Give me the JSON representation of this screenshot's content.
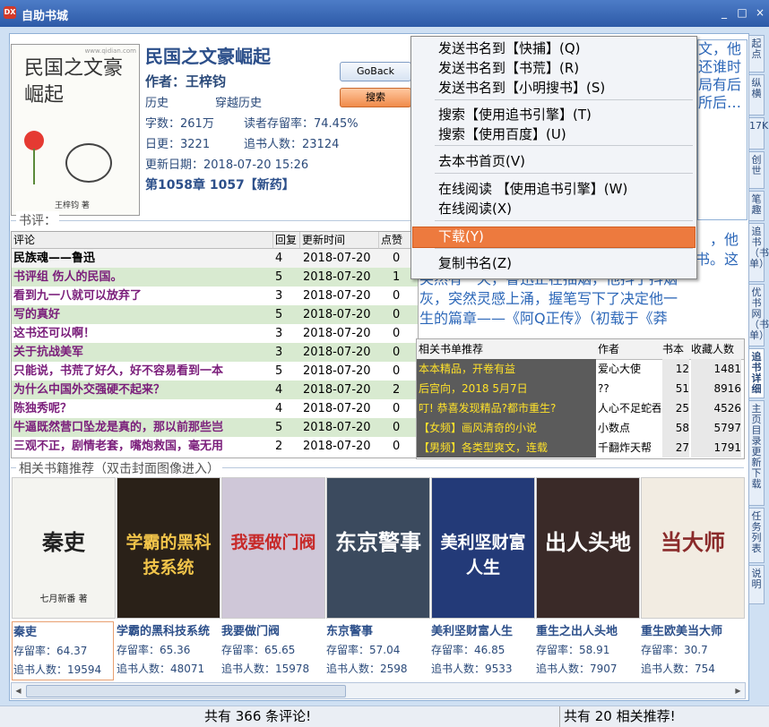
{
  "window": {
    "title": "自助书城",
    "icon_label": "DX",
    "buttons": [
      "_",
      "□",
      "×"
    ]
  },
  "book": {
    "title": "民国之文豪崛起",
    "author": "作者：王梓钧",
    "category": "历史",
    "subcategory": "穿越历史",
    "word_count": "字数：261万",
    "retention": "读者存留率：74.45%",
    "daily_update": "日更：3221",
    "followers": "追书人数：23124",
    "update_date": "更新日期：2018-07-20 15:26",
    "latest_chapter": "第1058章 1057【新药】",
    "cover": {
      "site": "www.qidian.com",
      "title_text": "民国之文豪崛起",
      "author_text": "王梓钧 著"
    }
  },
  "buttons": {
    "goback": "GoBack",
    "search": "搜索"
  },
  "description": {
    "right_text": "文，他还谁时局有后所后…"
  },
  "reviews": {
    "group_label": "书评：",
    "columns": [
      "评论",
      "回复",
      "更新时间",
      "点赞"
    ],
    "rows": [
      {
        "text": "民族魂——鲁迅",
        "replies": "4",
        "time": "2018-07-20",
        "likes": "0"
      },
      {
        "text": "书评组 伤人的民国。",
        "replies": "5",
        "time": "2018-07-20",
        "likes": "1"
      },
      {
        "text": "看到九一八就可以放弃了",
        "replies": "3",
        "time": "2018-07-20",
        "likes": "0"
      },
      {
        "text": "写的真好",
        "replies": "5",
        "time": "2018-07-20",
        "likes": "0"
      },
      {
        "text": "这书还可以啊！",
        "replies": "3",
        "time": "2018-07-20",
        "likes": "0"
      },
      {
        "text": "关于抗战美军",
        "replies": "3",
        "time": "2018-07-20",
        "likes": "0"
      },
      {
        "text": "只能说，书荒了好久，好不容易看到一本",
        "replies": "5",
        "time": "2018-07-20",
        "likes": "0"
      },
      {
        "text": "为什么中国外交强硬不起来？",
        "replies": "4",
        "time": "2018-07-20",
        "likes": "2"
      },
      {
        "text": "陈独秀呢？",
        "replies": "4",
        "time": "2018-07-20",
        "likes": "0"
      },
      {
        "text": "牛逼既然营口坠龙是真的，那以前那些岂",
        "replies": "5",
        "time": "2018-07-20",
        "likes": "0"
      },
      {
        "text": "三观不正，剧情老套，嘴炮救国，毫无用",
        "replies": "2",
        "time": "2018-07-20",
        "likes": "0"
      }
    ]
  },
  "review_excerpt": {
    "lines": [
      "，他",
      "书。这",
      "突然有一天，鲁迅正在抽烟，他抖了抖烟",
      "灰，突然灵感上涌，握笔写下了决定他一",
      "生的篇章——《阿Q正传》（初载于《莽"
    ]
  },
  "booklists": {
    "columns": [
      "相关书单推荐",
      "作者",
      "书本",
      "收藏人数"
    ],
    "rows": [
      {
        "name": "本本精品，开卷有益",
        "author": "爱心大使",
        "books": "12",
        "favs": "1481"
      },
      {
        "name": "后宫向，2018 5月7日",
        "author": "??",
        "books": "51",
        "favs": "8916"
      },
      {
        "name": "叮! 恭喜发现精品?都市重生?",
        "author": "人心不足蛇吞",
        "books": "25",
        "favs": "4526"
      },
      {
        "name": "【女频】画风清奇的小说",
        "author": "小数点",
        "books": "58",
        "favs": "5797"
      },
      {
        "name": "【男频】各类型爽文，连载",
        "author": "千翻炸天帮",
        "books": "27",
        "favs": "1791"
      }
    ]
  },
  "related": {
    "group_label": "相关书籍推荐（双击封面图像进入）",
    "books": [
      {
        "title": "秦吏",
        "retention": "存留率：64.37",
        "followers": "追书人数：19594",
        "cover_text": "秦吏",
        "cover_author": "七月新番 著",
        "bg": "#f4f4f0",
        "fg": "#222"
      },
      {
        "title": "学霸的黑科技系统",
        "retention": "存留率：65.36",
        "followers": "追书人数：48071",
        "cover_text": "学霸的黑科技系统",
        "cover_author": "",
        "bg": "#2a2118",
        "fg": "#f1c44a"
      },
      {
        "title": "我要做门阀",
        "retention": "存留率：65.65",
        "followers": "追书人数：15978",
        "cover_text": "我要做门阀",
        "cover_author": "",
        "bg": "#cfc7d8",
        "fg": "#c72a2a"
      },
      {
        "title": "东京警事",
        "retention": "存留率：57.04",
        "followers": "追书人数：2598",
        "cover_text": "东京警事",
        "cover_author": "",
        "bg": "#3b4a5e",
        "fg": "#ffffff"
      },
      {
        "title": "美利坚财富人生",
        "retention": "存留率：46.85",
        "followers": "追书人数：9533",
        "cover_text": "美利坚财富人生",
        "cover_author": "",
        "bg": "#233a78",
        "fg": "#ffffff"
      },
      {
        "title": "重生之出人头地",
        "retention": "存留率：58.91",
        "followers": "追书人数：7907",
        "cover_text": "出人头地",
        "cover_author": "",
        "bg": "#3a2a28",
        "fg": "#ffffff"
      },
      {
        "title": "重生欧美当大师",
        "retention": "存留率：30.7",
        "followers": "追书人数：754",
        "cover_text": "当大师",
        "cover_author": "",
        "bg": "#f2ece2",
        "fg": "#8a2a2a"
      }
    ]
  },
  "status": {
    "left": "共有 366 条评论!",
    "right": "共有 20 相关推荐!"
  },
  "side_tabs": [
    "起点",
    "纵横",
    "17K",
    "创世",
    "笔趣",
    "追书（书单）",
    "优书网（书单）",
    "追书详细",
    "主页目录更新下载",
    "任务列表",
    "说明"
  ],
  "context_menu": {
    "items": [
      "发送书名到【快捕】(Q)",
      "发送书名到【书荒】(R)",
      "发送书名到【小明搜书】(S)",
      "搜索【使用追书引擎】(T)",
      "搜索【使用百度】(U)",
      "去本书首页(V)",
      "在线阅读 【使用追书引擎】(W)",
      "在线阅读(X)",
      "下载(Y)",
      "复制书名(Z)"
    ],
    "highlighted_index": 8
  },
  "colors": {
    "menu_highlight": "#ed7a3e",
    "title_blue": "#2c4f8a",
    "review_purple": "#7a1d7a"
  }
}
